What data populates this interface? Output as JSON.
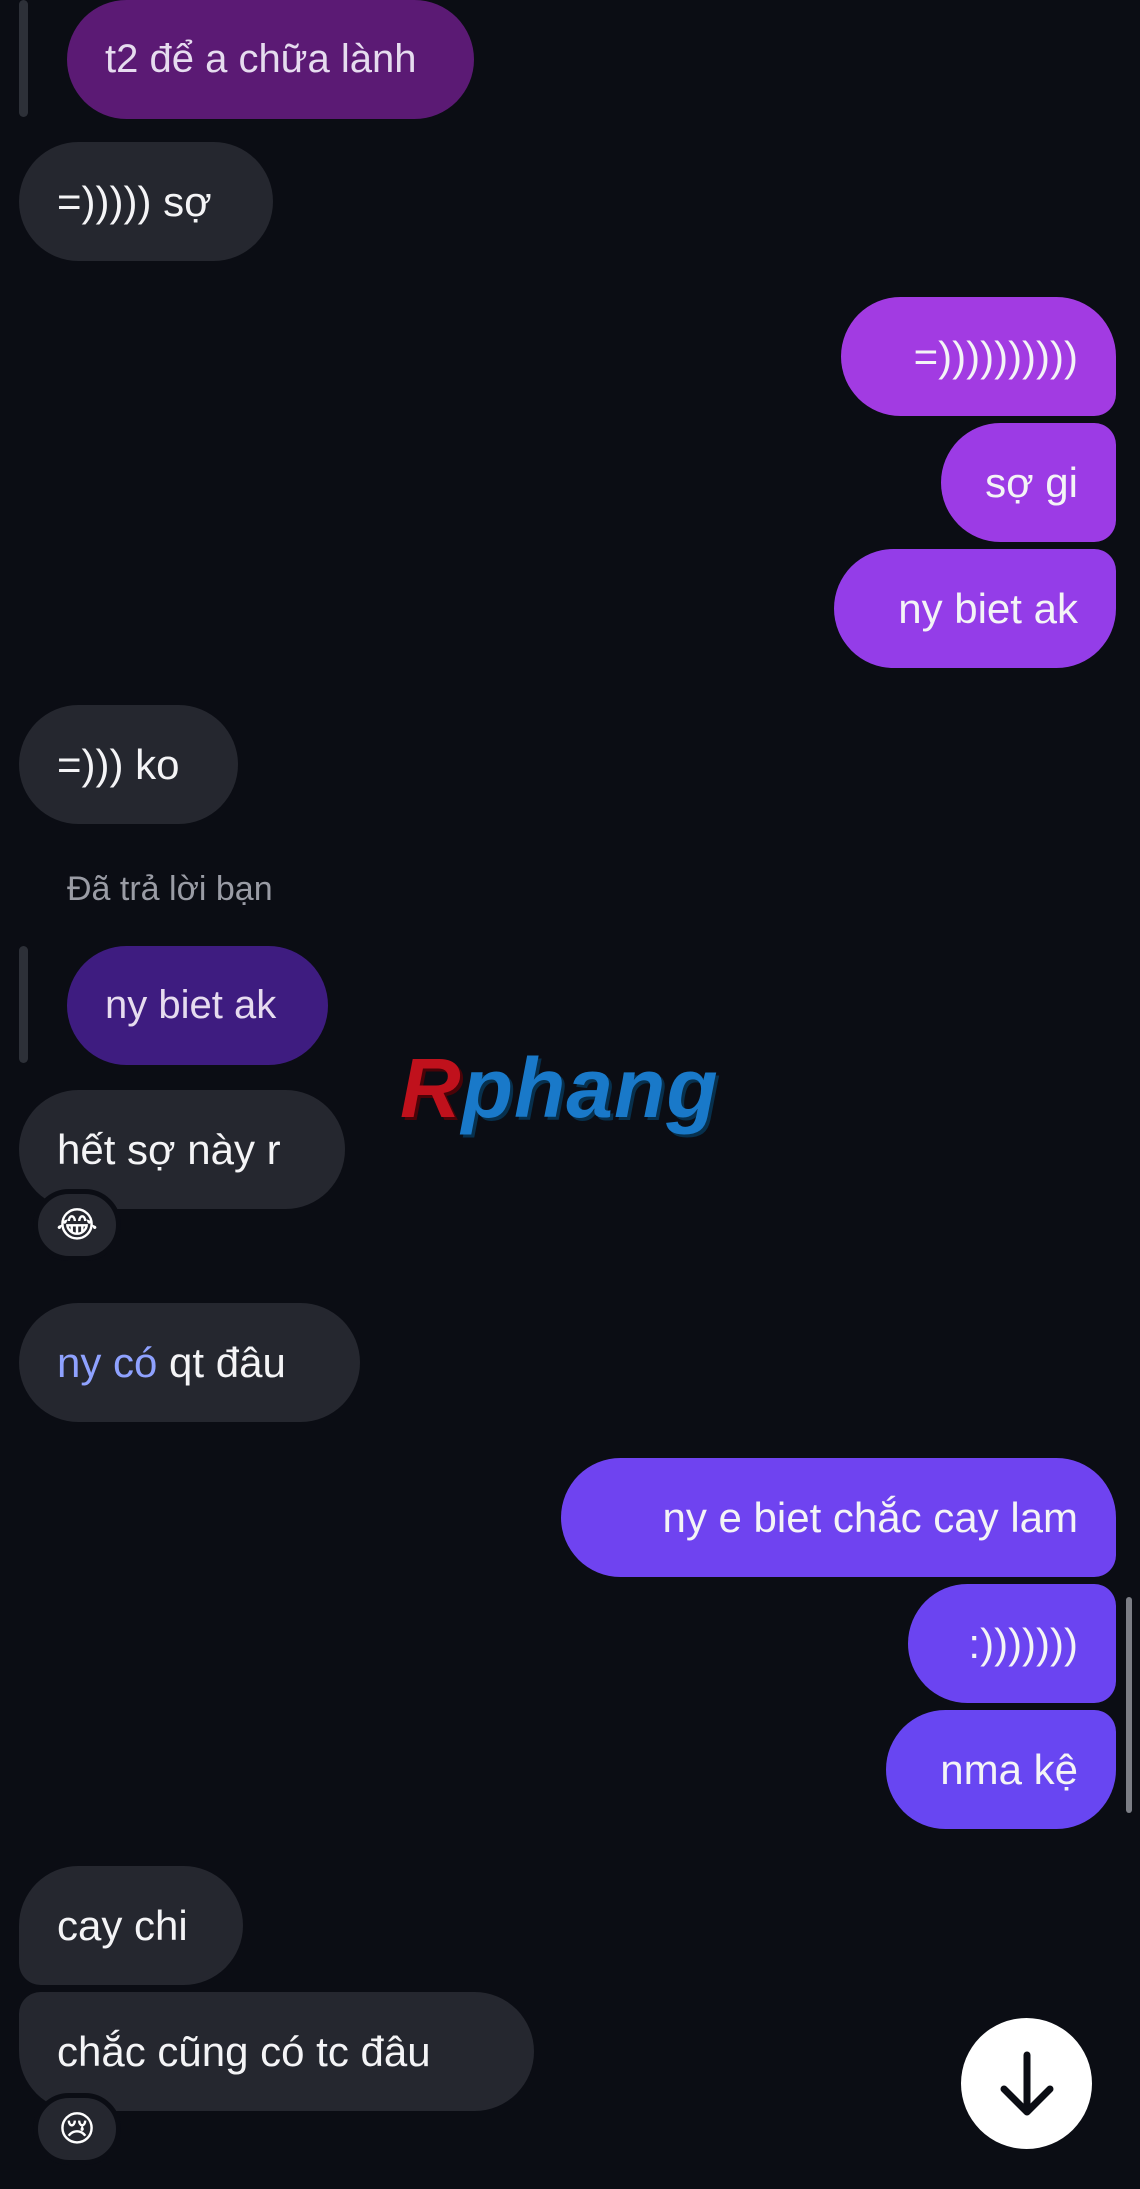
{
  "messages": [
    {
      "type": "reply_quote",
      "text": "t2 để a chữa lành",
      "color": "#5b1a74"
    },
    {
      "type": "received",
      "text": "=))))) sợ"
    },
    {
      "type": "sent",
      "text": "=))))))))))",
      "color": "#a23be2"
    },
    {
      "type": "sent",
      "text": "sợ gi",
      "color": "#9c3be5"
    },
    {
      "type": "sent",
      "text": "ny biet ak",
      "color": "#943de8"
    },
    {
      "type": "received",
      "text": "=))) ko"
    },
    {
      "type": "reply_caption",
      "text": "Đã trả lời bạn"
    },
    {
      "type": "reply_quote",
      "text": "ny biet ak",
      "color": "#3e1c80"
    },
    {
      "type": "received",
      "text": "hết sợ này r",
      "reaction": "😂"
    },
    {
      "type": "received",
      "mention": "ny có",
      "text": " qt đâu"
    },
    {
      "type": "sent",
      "text": "ny e biet chắc cay lam",
      "color": "#6f43f0"
    },
    {
      "type": "sent",
      "text": ":)))))))",
      "color": "#6b44f1"
    },
    {
      "type": "sent",
      "text": "nma kệ",
      "color": "#6846f2"
    },
    {
      "type": "received",
      "text": "cay chi"
    },
    {
      "type": "received",
      "text": "chắc cũng có tc đâu",
      "reaction": "😢"
    }
  ],
  "watermark": {
    "first": "R",
    "rest": "phang"
  },
  "scroll_down_icon": "arrow-down-icon"
}
